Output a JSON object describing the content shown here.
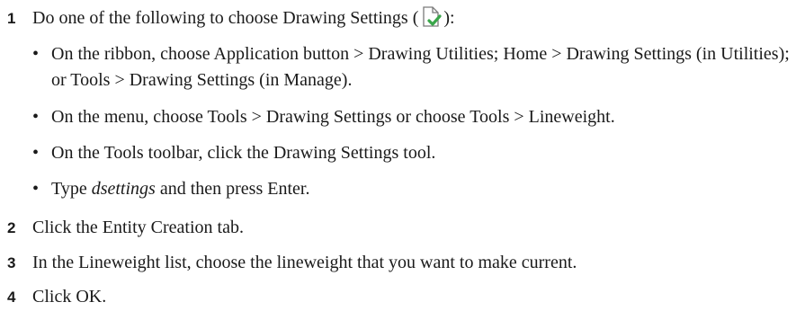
{
  "steps": [
    {
      "number": "1",
      "text_before_icon": "Do one of the following to choose Drawing Settings (",
      "icon": "drawing-settings-icon",
      "text_after_icon": "):",
      "bullets": [
        "On the ribbon, choose Application button > Drawing Utilities; Home > Drawing Settings (in Utilities); or Tools > Drawing Settings (in Manage).",
        "On the menu, choose Tools > Drawing Settings or choose Tools > Lineweight.",
        "On the Tools toolbar, click the Drawing Settings tool.",
        {
          "italic": "dsettings",
          "before": "Type ",
          "after": " and then press Enter."
        }
      ]
    },
    {
      "number": "2",
      "text": "Click the Entity Creation tab."
    },
    {
      "number": "3",
      "text": "In the Lineweight list, choose the lineweight that you want to make current."
    },
    {
      "number": "4",
      "text": "Click OK."
    }
  ],
  "colors": {
    "text": "#1a1a1a",
    "icon_check": "#3aa64a",
    "icon_outline": "#7a7a7a"
  }
}
